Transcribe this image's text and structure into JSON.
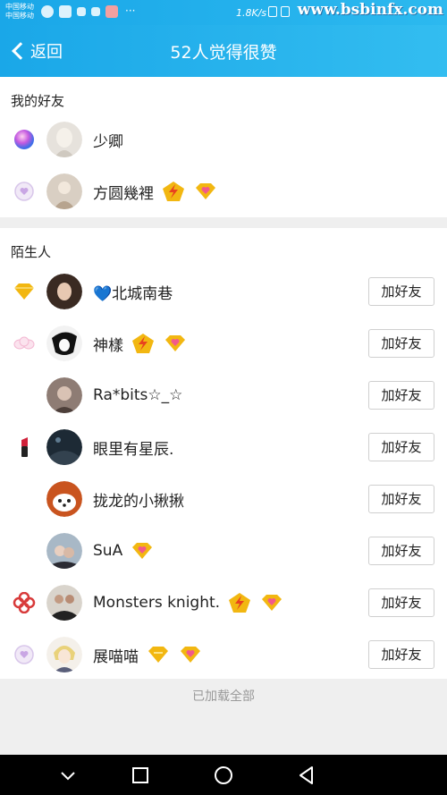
{
  "status_bar": {
    "carrier_line1": "中国移动",
    "carrier_line2": "中国移动",
    "network_speed": "1.8K/s",
    "watermark": "www.bsbinfx.com"
  },
  "header": {
    "back_label": "返回",
    "title": "52人觉得很赞"
  },
  "friends": {
    "section_title": "我的好友",
    "items": [
      {
        "name": "少卿"
      },
      {
        "name": "方圆幾裡"
      }
    ]
  },
  "strangers": {
    "section_title": "陌生人",
    "add_button_label": "加好友",
    "items": [
      {
        "name": "💙北城南巷"
      },
      {
        "name": "神樣"
      },
      {
        "name": "Ra*bits☆_☆"
      },
      {
        "name": "眼里有星辰."
      },
      {
        "name": "拢龙的小揪揪"
      },
      {
        "name": "SuA"
      },
      {
        "name": "Monsters knight."
      },
      {
        "name": "展喵喵"
      }
    ]
  },
  "footer_note": "已加载全部",
  "colors": {
    "header_bg": "#1aa7e8",
    "gold": "#f2b711",
    "pink": "#f25a8a"
  }
}
